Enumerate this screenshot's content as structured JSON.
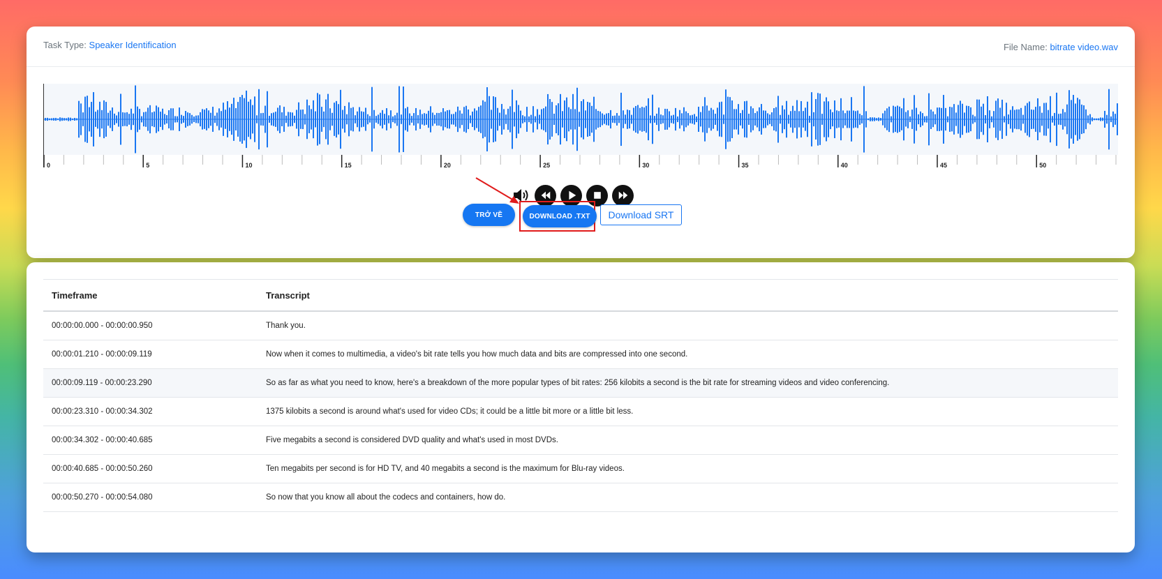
{
  "header": {
    "task_type_label": "Task Type:",
    "task_type_value": "Speaker Identification",
    "file_name_label": "File Name:",
    "file_name_value": "bitrate video.wav"
  },
  "waveform": {
    "duration_seconds": 54.08,
    "color": "#1976f2",
    "background": "#f4f7fb",
    "tick_labels": [
      "0",
      "5",
      "10",
      "15",
      "20",
      "25",
      "30",
      "35",
      "40",
      "45",
      "50"
    ]
  },
  "controls": {
    "icons": [
      "volume-icon",
      "rewind-icon",
      "play-icon",
      "stop-icon",
      "fast-forward-icon"
    ]
  },
  "buttons": {
    "back_label": "TRỞ VỀ",
    "download_txt_label": "DOWNLOAD .TXT",
    "download_srt_label": "Download SRT"
  },
  "annotation": {
    "highlight_color": "#e01b1b"
  },
  "table": {
    "headers": [
      "Timeframe",
      "Transcript"
    ],
    "rows": [
      {
        "timeframe": "00:00:00.000 - 00:00:00.950",
        "transcript": "Thank you."
      },
      {
        "timeframe": "00:00:01.210 - 00:00:09.119",
        "transcript": "Now when it comes to multimedia, a video's bit rate tells you how much data and bits are compressed into one second."
      },
      {
        "timeframe": "00:00:09.119 - 00:00:23.290",
        "transcript": "So as far as what you need to know, here's a breakdown of the more popular types of bit rates: 256 kilobits a second is the bit rate for streaming videos and video conferencing."
      },
      {
        "timeframe": "00:00:23.310 - 00:00:34.302",
        "transcript": "1375 kilobits a second is around what's used for video CDs; it could be a little bit more or a little bit less."
      },
      {
        "timeframe": "00:00:34.302 - 00:00:40.685",
        "transcript": "Five megabits a second is considered DVD quality and what's used in most DVDs."
      },
      {
        "timeframe": "00:00:40.685 - 00:00:50.260",
        "transcript": "Ten megabits per second is for HD TV, and 40 megabits a second is the maximum for Blu-ray videos."
      },
      {
        "timeframe": "00:00:50.270 - 00:00:54.080",
        "transcript": "So now that you know all about the codecs and containers, how do."
      }
    ]
  }
}
